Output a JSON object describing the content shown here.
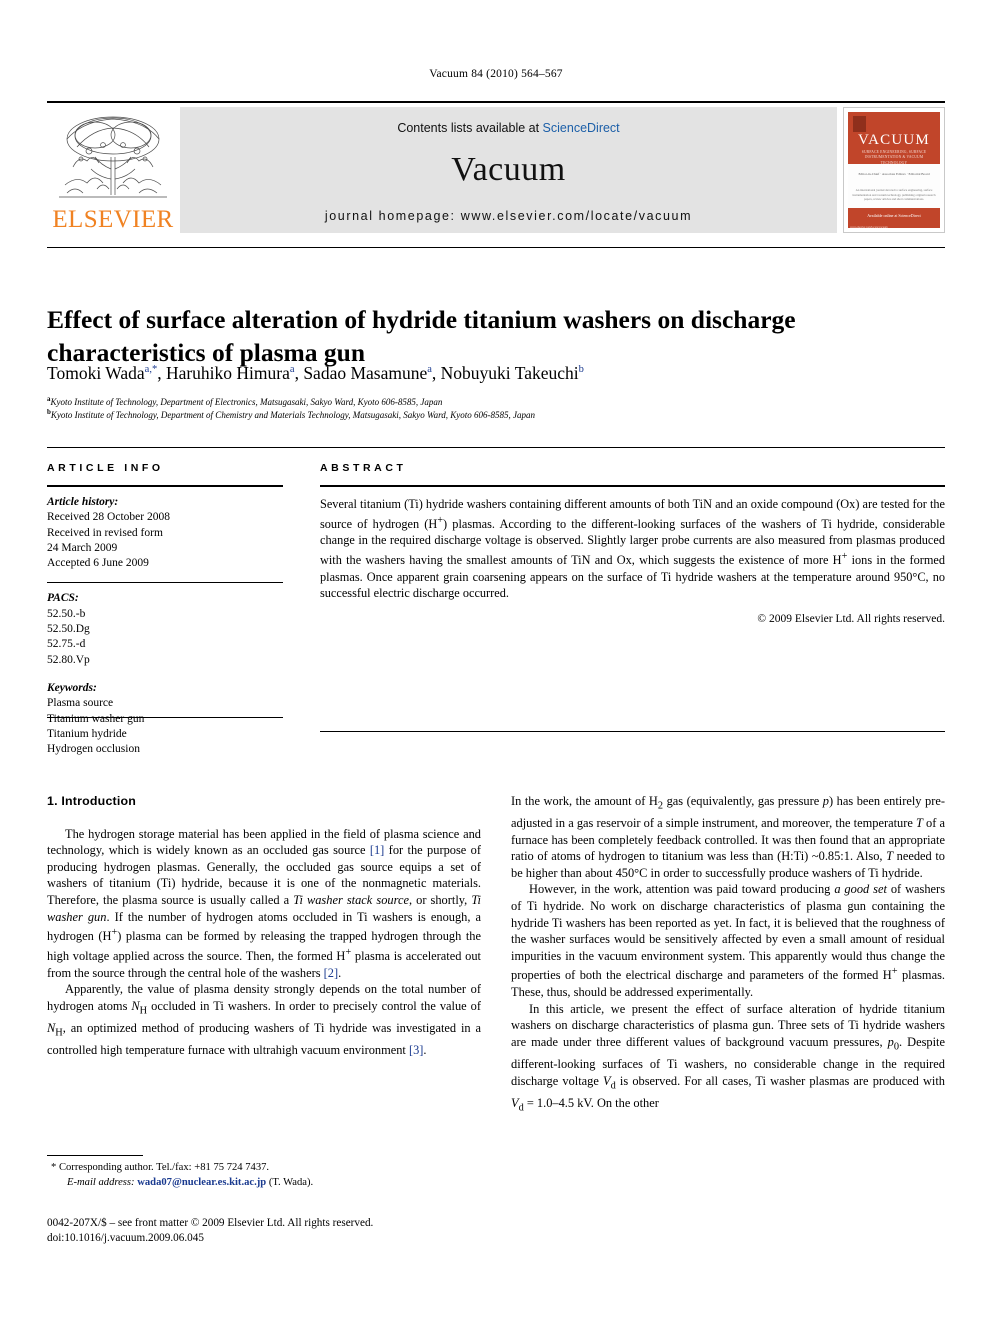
{
  "running_head": "Vacuum 84 (2010) 564–567",
  "masthead": {
    "publisher": "ELSEVIER",
    "contents_prefix": "Contents lists available at ",
    "contents_link": "ScienceDirect",
    "journal_name": "Vacuum",
    "homepage": "journal homepage: www.elsevier.com/locate/vacuum",
    "cover": {
      "title": "VACUUM",
      "subtitle": "SURFACE ENGINEERING, SURFACE INSTRUMENTATION & VACUUM TECHNOLOGY",
      "authors": "Editor-in-Chief  ·  Associate Editors  ·  Editorial Board",
      "abstract": "An international journal devoted to surface engineering, surface instrumentation and vacuum technology, publishing original research papers, review articles and short communications.",
      "sciencedirect": "Available online at\nScienceDirect",
      "footer": "www.elsevier.com/locate/vacuum"
    }
  },
  "article": {
    "title": "Effect of surface alteration of hydride titanium washers on discharge characteristics of plasma gun",
    "authors": [
      {
        "name": "Tomoki Wada",
        "marks": "a,*"
      },
      {
        "name": "Haruhiko Himura",
        "marks": "a"
      },
      {
        "name": "Sadao Masamune",
        "marks": "a"
      },
      {
        "name": "Nobuyuki Takeuchi",
        "marks": "b"
      }
    ],
    "affiliations": [
      {
        "mark": "a",
        "text": "Kyoto Institute of Technology, Department of Electronics, Matsugasaki, Sakyo Ward, Kyoto 606-8585, Japan"
      },
      {
        "mark": "b",
        "text": "Kyoto Institute of Technology, Department of Chemistry and Materials Technology, Matsugasaki, Sakyo Ward, Kyoto 606-8585, Japan"
      }
    ]
  },
  "article_info": {
    "heading": "ARTICLE INFO",
    "history_label": "Article history:",
    "history_lines": [
      "Received 28 October 2008",
      "Received in revised form",
      "24 March 2009",
      "Accepted 6 June 2009"
    ],
    "pacs_label": "PACS:",
    "pacs": [
      "52.50.-b",
      "52.50.Dg",
      "52.75.-d",
      "52.80.Vp"
    ],
    "keywords_label": "Keywords:",
    "keywords": [
      "Plasma source",
      "Titanium washer gun",
      "Titanium hydride",
      "Hydrogen occlusion"
    ]
  },
  "abstract": {
    "heading": "ABSTRACT",
    "text_parts": [
      "Several titanium (Ti) hydride washers containing different amounts of both TiN and an oxide compound (Ox) are tested for the source of hydrogen (H",
      "+",
      ") plasmas. According to the different-looking surfaces of the washers of Ti hydride, considerable change in the required discharge voltage is observed. Slightly larger probe currents are also measured from plasmas produced with the washers having the smallest amounts of TiN and Ox, which suggests the existence of more H",
      "+",
      " ions in the formed plasmas. Once apparent grain coarsening appears on the surface of Ti hydride washers at the temperature around 950°C, no successful electric discharge occurred."
    ],
    "copyright": "© 2009 Elsevier Ltd. All rights reserved."
  },
  "body": {
    "section1_heading": "1.  Introduction",
    "left_paragraphs": [
      "The hydrogen storage material has been applied in the field of plasma science and technology, which is widely known as an occluded gas source [1] for the purpose of producing hydrogen plasmas. Generally, the occluded gas source equips a set of washers of titanium (Ti) hydride, because it is one of the nonmagnetic materials. Therefore, the plasma source is usually called a Ti washer stack source, or shortly, Ti washer gun. If the number of hydrogen atoms occluded in Ti washers is enough, a hydrogen (H+) plasma can be formed by releasing the trapped hydrogen through the high voltage applied across the source. Then, the formed H+ plasma is accelerated out from the source through the central hole of the washers [2].",
      "Apparently, the value of plasma density strongly depends on the total number of hydrogen atoms NH occluded in Ti washers. In order to precisely control the value of NH, an optimized method of producing washers of Ti hydride was investigated in a controlled high temperature furnace with ultrahigh vacuum environment [3]."
    ],
    "right_paragraphs": [
      "In the work, the amount of H2 gas (equivalently, gas pressure p) has been entirely pre-adjusted in a gas reservoir of a simple instrument, and moreover, the temperature T of a furnace has been completely feedback controlled. It was then found that an appropriate ratio of atoms of hydrogen to titanium was less than (H:Ti) ~0.85:1. Also, T needed to be higher than about 450°C in order to successfully produce washers of Ti hydride.",
      "However, in the work, attention was paid toward producing a good set of washers of Ti hydride. No work on discharge characteristics of plasma gun containing the hydride Ti washers has been reported as yet. In fact, it is believed that the roughness of the washer surfaces would be sensitively affected by even a small amount of residual impurities in the vacuum environment system. This apparently would thus change the properties of both the electrical discharge and parameters of the formed H+ plasmas. These, thus, should be addressed experimentally.",
      "In this article, we present the effect of surface alteration of hydride titanium washers on discharge characteristics of plasma gun. Three sets of Ti hydride washers are made under three different values of background vacuum pressures, p0. Despite different-looking surfaces of Ti washers, no considerable change in the required discharge voltage Vd is observed. For all cases, Ti washer plasmas are produced with Vd = 1.0–4.5 kV. On the other"
    ]
  },
  "footnote": {
    "corresponding": "* Corresponding author. Tel./fax: +81 75 724 7437.",
    "email_label": "E-mail address:",
    "email": "wada07@nuclear.es.kit.ac.jp",
    "email_suffix": "(T. Wada)."
  },
  "page_footer": {
    "line1": "0042-207X/$ – see front matter © 2009 Elsevier Ltd. All rights reserved.",
    "line2": "doi:10.1016/j.vacuum.2009.06.045"
  },
  "colors": {
    "link": "#1a3a8f",
    "sciencedirect": "#1c5fa8",
    "elsevier_orange": "#F08222",
    "cover_red": "#c1452a",
    "masthead_grey": "#e3e3e3"
  }
}
